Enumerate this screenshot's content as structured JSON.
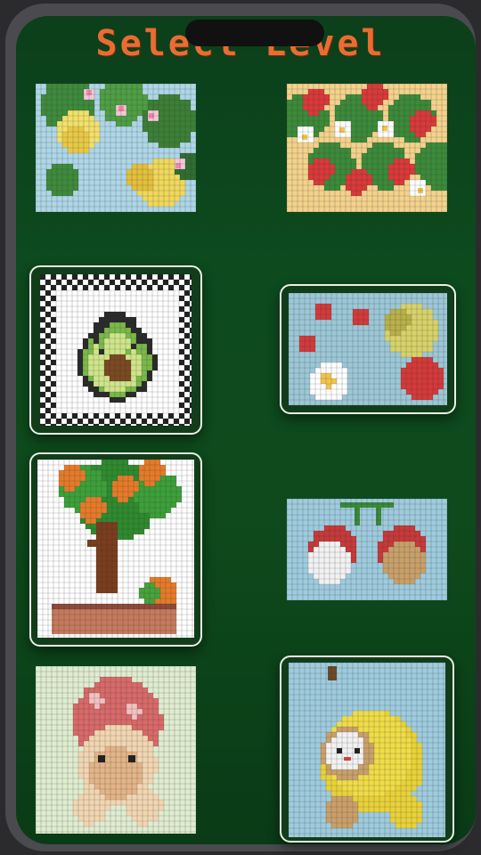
{
  "screen": {
    "title": "Select Level"
  },
  "levels": [
    {
      "name": "lemon-branch",
      "framed": false,
      "selected": false
    },
    {
      "name": "strawberry-flowers",
      "framed": false,
      "selected": false
    },
    {
      "name": "avocado",
      "framed": true,
      "selected": false
    },
    {
      "name": "strawberry-daisy",
      "framed": true,
      "selected": false
    },
    {
      "name": "orange-tree",
      "framed": true,
      "selected": false
    },
    {
      "name": "cherry-kittens",
      "framed": false,
      "selected": false
    },
    {
      "name": "mushroom-kitten",
      "framed": false,
      "selected": false
    },
    {
      "name": "banana-kitten",
      "framed": true,
      "selected": false
    }
  ],
  "colors": {
    "background": "#0d4a1e",
    "title": "#e86d33",
    "frame": "#e9f2e4",
    "grid_line": "#cfd6cf"
  }
}
